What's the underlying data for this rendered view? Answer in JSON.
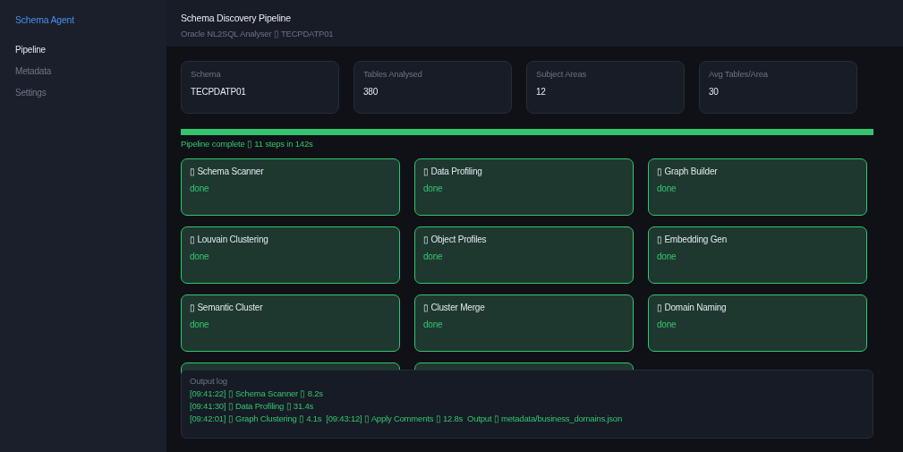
{
  "sidebar": {
    "brand": "Schema Agent",
    "items": [
      {
        "label": "Pipeline",
        "selected": true
      },
      {
        "label": "Metadata",
        "selected": false
      },
      {
        "label": "Settings",
        "selected": false
      }
    ]
  },
  "header": {
    "title": "Schema Discovery Pipeline",
    "subtitle": "Oracle NL2SQL Analyser ▯ TECPDATP01"
  },
  "stats": [
    {
      "label": "Schema",
      "value": "TECPDATP01"
    },
    {
      "label": "Tables Analysed",
      "value": "380"
    },
    {
      "label": "Subject Areas",
      "value": "12"
    },
    {
      "label": "Avg Tables/Area",
      "value": "30"
    }
  ],
  "progress": {
    "level": 1,
    "caption": "Pipeline complete ▯ 11 steps in 142s"
  },
  "steps": [
    {
      "title": "▯ Schema Scanner",
      "status": "done"
    },
    {
      "title": "▯ Data Profiling",
      "status": "done"
    },
    {
      "title": "▯ Graph Builder",
      "status": "done"
    },
    {
      "title": "▯ Louvain Clustering",
      "status": "done"
    },
    {
      "title": "▯ Object Profiles",
      "status": "done"
    },
    {
      "title": "▯ Embedding Gen",
      "status": "done"
    },
    {
      "title": "▯ Semantic Cluster",
      "status": "done"
    },
    {
      "title": "▯ Cluster Merge",
      "status": "done"
    },
    {
      "title": "▯ Domain Naming",
      "status": "done"
    }
  ],
  "covered_steps": [
    {
      "complete": true
    },
    {
      "complete": true
    }
  ],
  "output_log": {
    "title": "Output log",
    "lines": [
      "[09:41:22] ▯ Schema Scanner ▯ 8.2s",
      "[09:41:30] ▯ Data Profiling ▯ 31.4s",
      "[09:42:01] ▯ Graph Clustering ▯ 4.1s  [09:43:12] ▯ Apply Comments ▯ 12.8s  Output ▯ metadata/business_domains.json"
    ]
  }
}
